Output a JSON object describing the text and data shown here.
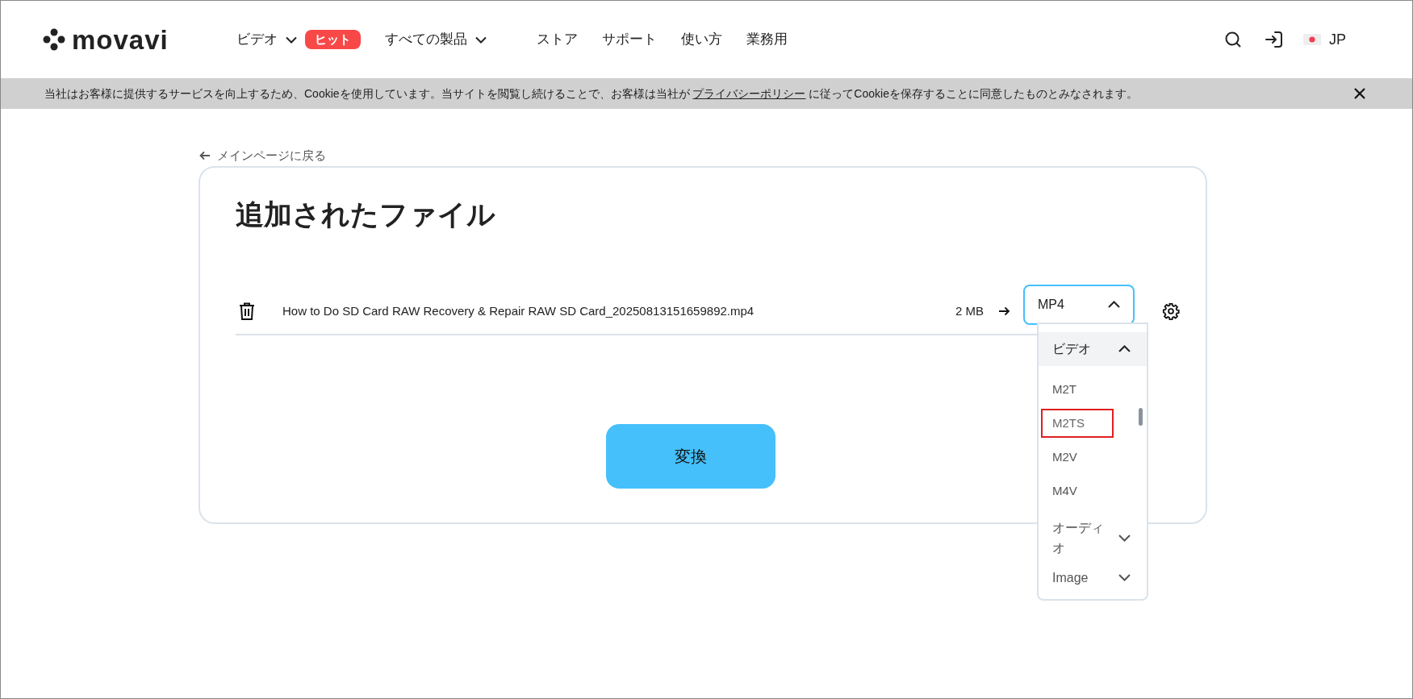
{
  "header": {
    "logo": "movavi",
    "nav": [
      {
        "label": "ビデオ",
        "dropdown": true,
        "badge": "ヒット"
      },
      {
        "label": "すべての製品",
        "dropdown": true
      },
      {
        "label": "ストア",
        "dropdown": false
      },
      {
        "label": "サポート",
        "dropdown": false
      },
      {
        "label": "使い方",
        "dropdown": false
      },
      {
        "label": "業務用",
        "dropdown": false
      }
    ],
    "language": "JP"
  },
  "cookie_bar": {
    "text_before": "当社はお客様に提供するサービスを向上するため、Cookieを使用しています。当サイトを閲覧し続けることで、お客様は当社が",
    "link": "プライバシーポリシー",
    "text_after": "に従ってCookieを保存することに同意したものとみなされます。"
  },
  "back_link": "メインページに戻る",
  "card": {
    "title": "追加されたファイル",
    "files": [
      {
        "name": "How to Do SD Card RAW Recovery & Repair RAW SD Card_20250813151659892.mp4",
        "size": "2 MB",
        "format": "MP4",
        "expanded": true
      }
    ],
    "format_menu": [
      {
        "label": "ビデオ",
        "expanded": true,
        "items": [
          {
            "label": "M2T",
            "highlighted": false
          },
          {
            "label": "M2TS",
            "highlighted": true
          },
          {
            "label": "M2V",
            "highlighted": false
          },
          {
            "label": "M4V",
            "highlighted": false
          }
        ]
      },
      {
        "label": "オーディオ",
        "expanded": false
      },
      {
        "label": "Image",
        "expanded": false
      }
    ],
    "convert_button": "変換"
  }
}
